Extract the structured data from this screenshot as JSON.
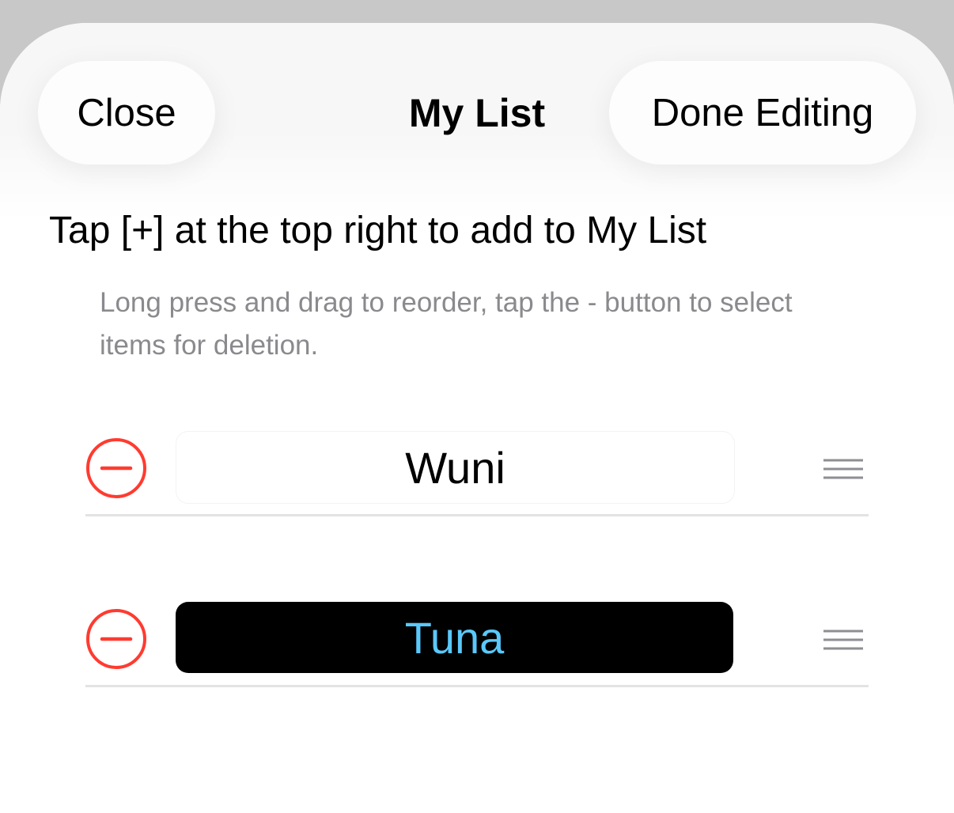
{
  "header": {
    "close_label": "Close",
    "title": "My List",
    "done_label": "Done Editing"
  },
  "hint": "Tap [+] at the top right to add to My List",
  "subhint": "Long press and drag to reorder, tap the - button to select items for deletion.",
  "items": [
    {
      "label": "Wuni",
      "style": "plain",
      "delete_icon": "minus-circle-icon",
      "drag_icon": "drag-handle-icon"
    },
    {
      "label": "Tuna",
      "style": "dark",
      "delete_icon": "minus-circle-icon",
      "drag_icon": "drag-handle-icon"
    }
  ],
  "colors": {
    "delete_red": "#ff3b30",
    "accent_blue": "#5ac8fa",
    "secondary_text": "#8a8a8e"
  }
}
